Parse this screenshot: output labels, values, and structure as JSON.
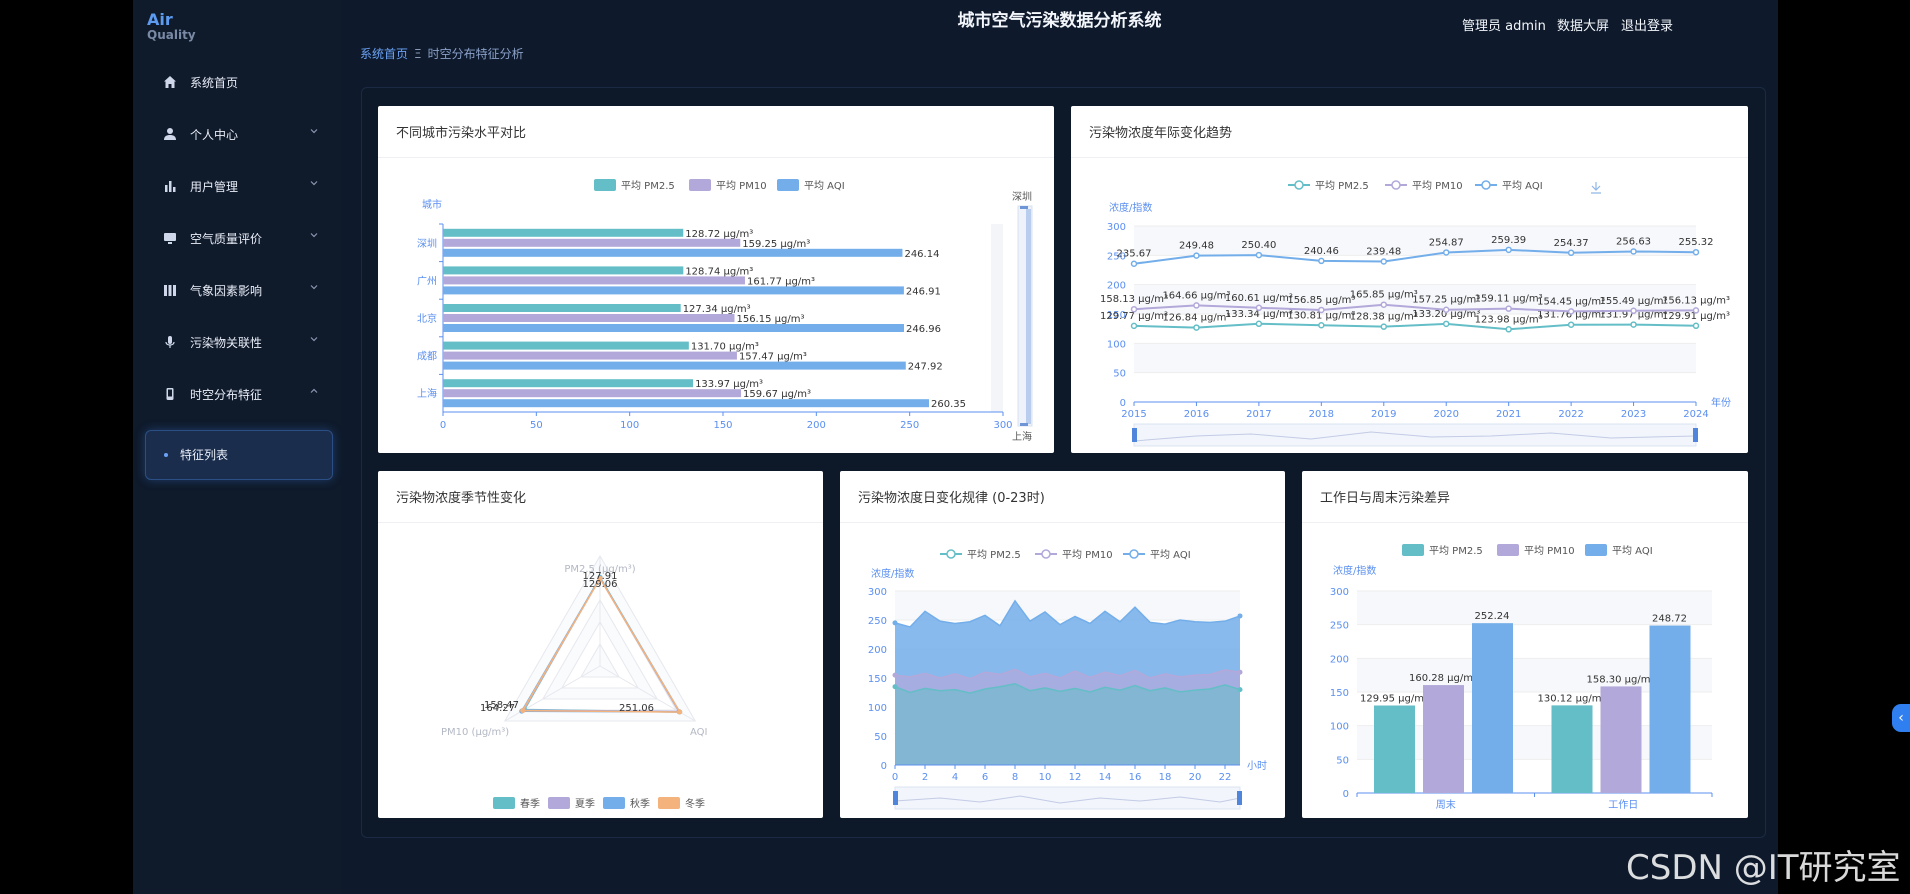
{
  "app": {
    "logo_main": "Air",
    "logo_sub": "Quality",
    "title": "城市空气污染数据分析系统",
    "user_label": "管理员 admin",
    "bigscreen_label": "数据大屏",
    "logout_label": "退出登录",
    "watermark": "CSDN @IT研究室",
    "side_tab_glyph": "‹"
  },
  "breadcrumb": {
    "home": "系统首页",
    "sep": "Ξ",
    "current": "时空分布特征分析"
  },
  "sidebar": {
    "items": [
      {
        "label": "系统首页",
        "icon": "home-icon"
      },
      {
        "label": "个人中心",
        "icon": "user-icon"
      },
      {
        "label": "用户管理",
        "icon": "bar-chart-icon"
      },
      {
        "label": "空气质量评价",
        "icon": "monitor-icon"
      },
      {
        "label": "气象因素影响",
        "icon": "columns-icon"
      },
      {
        "label": "污染物关联性",
        "icon": "microphone-icon"
      },
      {
        "label": "时空分布特征",
        "icon": "mobile-icon"
      }
    ],
    "sub_item": "特征列表"
  },
  "colors": {
    "teal": "#64bec7",
    "purple": "#b3a8da",
    "blue": "#73aeea",
    "orange": "#f4b27d"
  },
  "charts": {
    "city": {
      "title": "不同城市污染水平对比",
      "legend": [
        "平均 PM2.5",
        "平均 PM10",
        "平均 AQI"
      ],
      "axis_name": "城市",
      "zoom_top": "深圳",
      "zoom_bottom": "上海",
      "x_ticks": [
        "0",
        "50",
        "100",
        "150",
        "200",
        "250",
        "300"
      ]
    },
    "year": {
      "title": "污染物浓度年际变化趋势",
      "legend": [
        "平均 PM2.5",
        "平均 PM10",
        "平均 AQI"
      ],
      "y_name": "浓度/指数",
      "x_name": "年份",
      "y_ticks": [
        "300",
        "250",
        "200",
        "150",
        "100",
        "50",
        "0"
      ]
    },
    "season": {
      "title": "污染物浓度季节性变化",
      "indicators": [
        "PM2.5 (μg/m³)",
        "PM10 (μg/m³)",
        "AQI"
      ],
      "legend": [
        "春季",
        "夏季",
        "秋季",
        "冬季"
      ],
      "labels": [
        "129.06",
        "127.91",
        "164.27",
        "158.47",
        "251.06"
      ]
    },
    "daily": {
      "title": "污染物浓度日变化规律 (0-23时)",
      "legend": [
        "平均 PM2.5",
        "平均 PM10",
        "平均 AQI"
      ],
      "y_name": "浓度/指数",
      "x_name": "小时",
      "y_ticks": [
        "300",
        "250",
        "200",
        "150",
        "100",
        "50",
        "0"
      ],
      "x_ticks": [
        "0",
        "2",
        "4",
        "6",
        "8",
        "10",
        "12",
        "14",
        "16",
        "18",
        "20",
        "22"
      ]
    },
    "week": {
      "title": "工作日与周末污染差异",
      "legend": [
        "平均 PM2.5",
        "平均 PM10",
        "平均 AQI"
      ],
      "y_name": "浓度/指数",
      "y_ticks": [
        "300",
        "250",
        "200",
        "150",
        "100",
        "50",
        "0"
      ]
    }
  },
  "chart_data": [
    {
      "type": "bar",
      "orientation": "horizontal",
      "categories": [
        "深圳",
        "广州",
        "北京",
        "成都",
        "上海"
      ],
      "series": [
        {
          "name": "平均 PM2.5",
          "values": [
            128.72,
            128.74,
            127.34,
            131.7,
            133.97
          ],
          "labels": [
            "128.72 μg/m³",
            "128.74 μg/m³",
            "127.34 μg/m³",
            "131.70 μg/m³",
            "133.97 μg/m³"
          ]
        },
        {
          "name": "平均 PM10",
          "values": [
            159.25,
            161.77,
            156.15,
            157.47,
            159.67
          ],
          "labels": [
            "159.25 μg/m³",
            "161.77 μg/m³",
            "156.15 μg/m³",
            "157.47 μg/m³",
            "159.67 μg/m³"
          ]
        },
        {
          "name": "平均 AQI",
          "values": [
            246.14,
            246.91,
            246.96,
            247.92,
            260.35
          ],
          "labels": [
            "246.14",
            "246.91",
            "246.96",
            "247.92",
            "260.35"
          ]
        }
      ],
      "ylabel": "城市",
      "xlim": [
        0,
        300
      ]
    },
    {
      "type": "line",
      "x": [
        "2015",
        "2016",
        "2017",
        "2018",
        "2019",
        "2020",
        "2021",
        "2022",
        "2023",
        "2024"
      ],
      "series": [
        {
          "name": "平均 PM2.5",
          "values": [
            129.77,
            126.84,
            133.34,
            130.81,
            128.38,
            133.2,
            123.98,
            131.76,
            131.97,
            129.91
          ],
          "labels": [
            "129.77 μg/m³",
            "126.84 μg/m³",
            "133.34 μg/m³",
            "130.81 μg/m³",
            "128.38 μg/m³",
            "133.20 μg/m³",
            "123.98 μg/m³",
            "131.76 μg/m³",
            "131.97 μg/m³",
            "129.91 μg/m³"
          ]
        },
        {
          "name": "平均 PM10",
          "values": [
            158.13,
            164.66,
            160.61,
            156.85,
            165.85,
            157.25,
            159.11,
            154.45,
            155.49,
            156.13
          ],
          "labels": [
            "158.13 μg/m³",
            "164.66 μg/m³",
            "160.61 μg/m³",
            "156.85 μg/m³",
            "165.85 μg/m³",
            "157.25 μg/m³",
            "159.11 μg/m³",
            "154.45 μg/m³",
            "155.49 μg/m³",
            "156.13 μg/m³"
          ]
        },
        {
          "name": "平均 AQI",
          "values": [
            235.67,
            249.48,
            250.4,
            240.46,
            239.48,
            254.87,
            259.39,
            254.37,
            256.63,
            255.32
          ],
          "labels": [
            "235.67",
            "249.48",
            "250.40",
            "240.46",
            "239.48",
            "254.87",
            "259.39",
            "254.37",
            "256.63",
            "255.32"
          ]
        }
      ],
      "ylabel": "浓度/指数",
      "xlabel": "年份",
      "ylim": [
        0,
        300
      ]
    },
    {
      "type": "radar",
      "indicators": [
        "PM2.5 (μg/m³)",
        "PM10 (μg/m³)",
        "AQI"
      ],
      "max": [
        160,
        200,
        300
      ],
      "series": [
        {
          "name": "春季",
          "values": [
            129.06,
            158.47,
            251.06
          ]
        },
        {
          "name": "夏季",
          "values": [
            127.91,
            160.5,
            248.6
          ]
        },
        {
          "name": "秋季",
          "values": [
            128.4,
            164.27,
            250.2
          ]
        },
        {
          "name": "冬季",
          "values": [
            127.5,
            162.3,
            251.0
          ]
        }
      ]
    },
    {
      "type": "area",
      "x": [
        0,
        1,
        2,
        3,
        4,
        5,
        6,
        7,
        8,
        9,
        10,
        11,
        12,
        13,
        14,
        15,
        16,
        17,
        18,
        19,
        20,
        21,
        22,
        23
      ],
      "series": [
        {
          "name": "平均 PM2.5",
          "values": [
            135,
            125,
            132,
            128,
            130,
            124,
            131,
            135,
            140,
            128,
            133,
            127,
            132,
            126,
            134,
            129,
            137,
            128,
            133,
            126,
            129,
            131,
            138,
            130
          ]
        },
        {
          "name": "平均 PM10",
          "values": [
            155,
            152,
            158,
            150,
            157,
            149,
            160,
            156,
            165,
            152,
            158,
            150,
            162,
            151,
            160,
            154,
            163,
            150,
            157,
            152,
            155,
            156,
            164,
            160
          ]
        },
        {
          "name": "平均 AQI",
          "values": [
            245,
            238,
            265,
            248,
            244,
            247,
            258,
            240,
            283,
            248,
            264,
            242,
            256,
            244,
            265,
            247,
            272,
            246,
            243,
            250,
            247,
            246,
            248,
            257
          ]
        }
      ],
      "ylabel": "浓度/指数",
      "xlabel": "小时",
      "ylim": [
        0,
        300
      ]
    },
    {
      "type": "bar",
      "categories": [
        "周末",
        "工作日"
      ],
      "series": [
        {
          "name": "平均 PM2.5",
          "values": [
            129.95,
            130.12
          ],
          "labels": [
            "129.95 μg/m³",
            "130.12 μg/m³"
          ]
        },
        {
          "name": "平均 PM10",
          "values": [
            160.28,
            158.3
          ],
          "labels": [
            "160.28 μg/m³",
            "158.30 μg/m³"
          ]
        },
        {
          "name": "平均 AQI",
          "values": [
            252.24,
            248.72
          ],
          "labels": [
            "252.24",
            "248.72"
          ]
        }
      ],
      "ylabel": "浓度/指数",
      "ylim": [
        0,
        300
      ]
    }
  ]
}
